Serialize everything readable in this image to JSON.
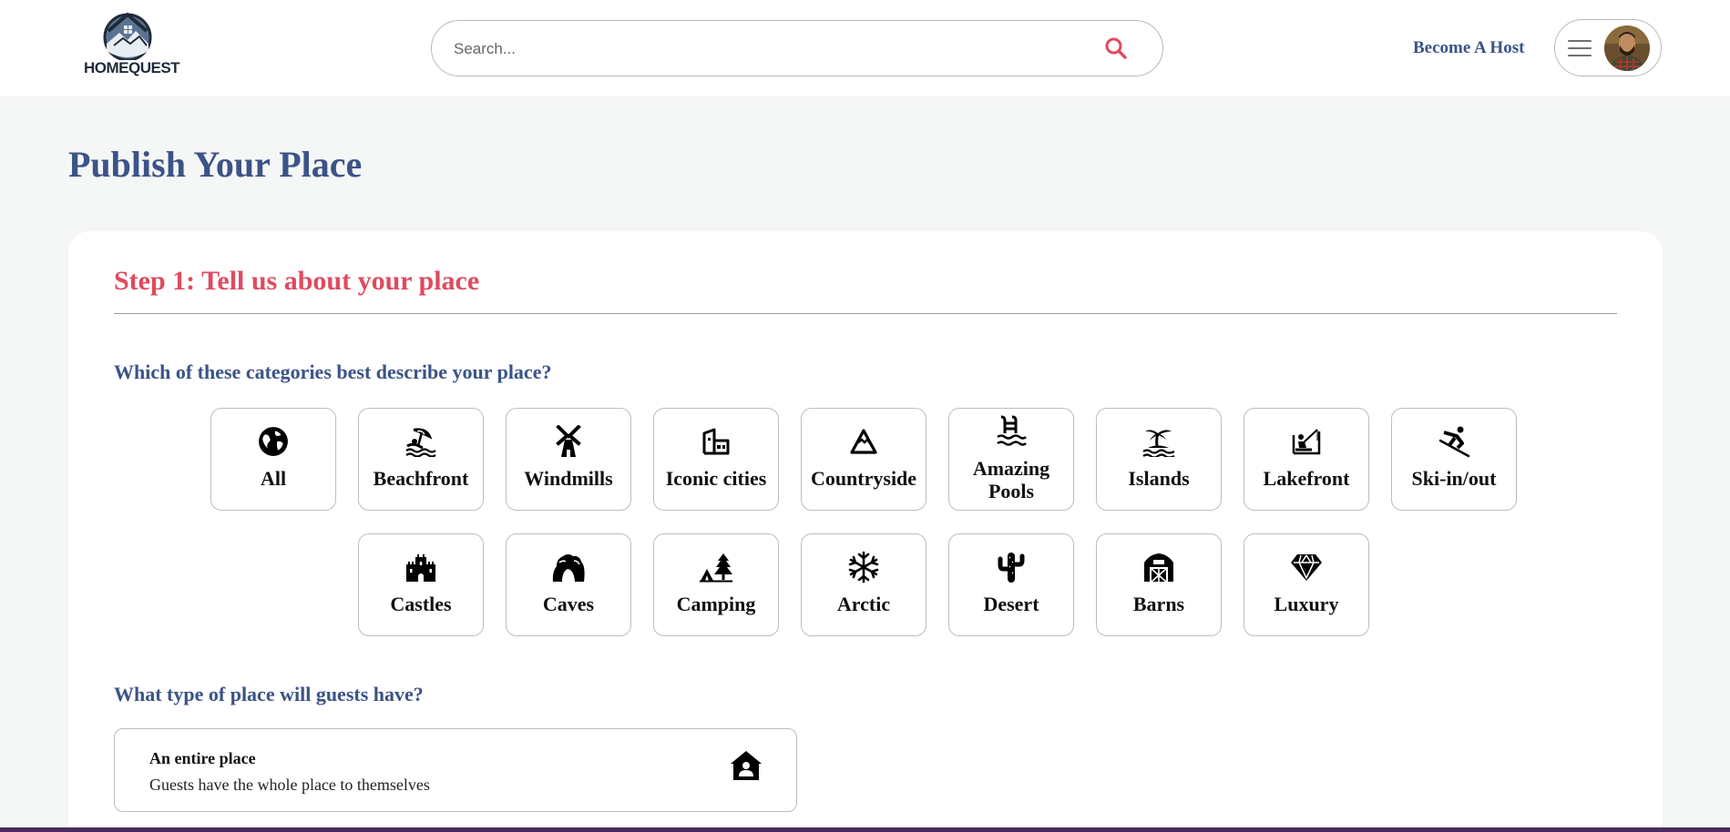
{
  "header": {
    "brand": "HOMEQUEST",
    "search_placeholder": "Search...",
    "become_host": "Become A Host"
  },
  "page": {
    "title": "Publish Your Place"
  },
  "step": {
    "title": "Step 1: Tell us about your place",
    "categories_question": "Which of these categories best describe your place?",
    "categories": [
      {
        "label": "All",
        "icon": "globe-icon"
      },
      {
        "label": "Beachfront",
        "icon": "beach-umbrella-icon"
      },
      {
        "label": "Windmills",
        "icon": "windmill-icon"
      },
      {
        "label": "Iconic cities",
        "icon": "city-building-icon"
      },
      {
        "label": "Countryside",
        "icon": "mountain-icon"
      },
      {
        "label": "Amazing Pools",
        "icon": "pool-ladder-icon"
      },
      {
        "label": "Islands",
        "icon": "island-palm-icon"
      },
      {
        "label": "Lakefront",
        "icon": "fishing-icon"
      },
      {
        "label": "Ski-in/out",
        "icon": "skier-icon"
      },
      {
        "label": "Castles",
        "icon": "castle-icon"
      },
      {
        "label": "Caves",
        "icon": "cave-icon"
      },
      {
        "label": "Camping",
        "icon": "tent-tree-icon"
      },
      {
        "label": "Arctic",
        "icon": "snowflake-icon"
      },
      {
        "label": "Desert",
        "icon": "cactus-icon"
      },
      {
        "label": "Barns",
        "icon": "barn-icon"
      },
      {
        "label": "Luxury",
        "icon": "diamond-icon"
      }
    ],
    "place_type_question": "What type of place will guests have?",
    "place_types": [
      {
        "title": "An entire place",
        "description": "Guests have the whole place to themselves",
        "icon": "house-user-icon"
      }
    ]
  },
  "colors": {
    "brand_blue": "#3b5387",
    "accent_red": "#e04a5f",
    "page_bg": "#f5f6f6"
  }
}
